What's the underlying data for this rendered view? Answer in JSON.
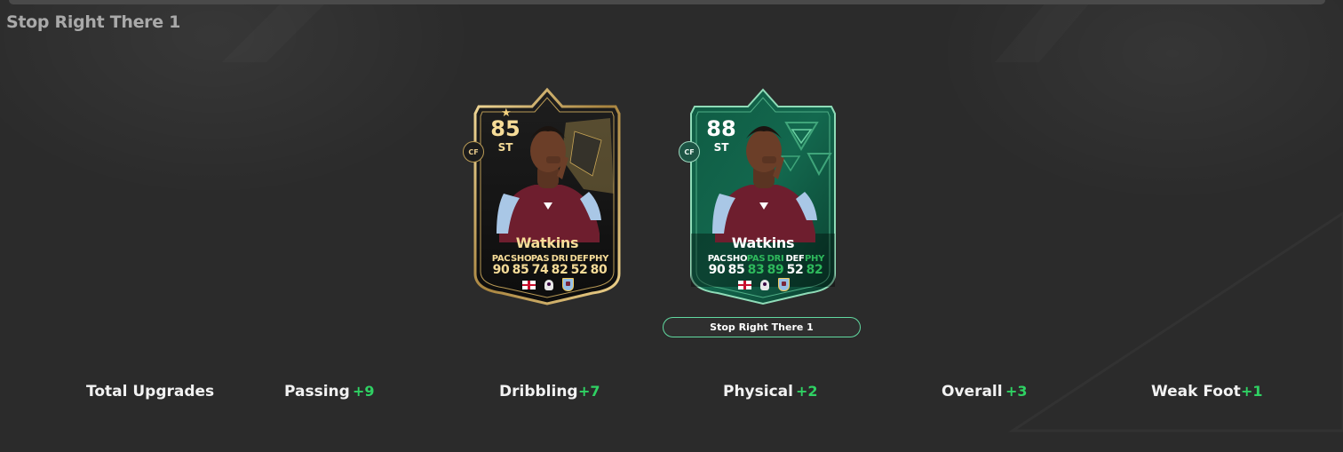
{
  "page": {
    "title": "Stop Right There 1"
  },
  "cards": {
    "base": {
      "rating": "85",
      "position": "ST",
      "alt_position": "CF",
      "name": "Watkins",
      "stats": [
        {
          "label": "PAC",
          "value": "90"
        },
        {
          "label": "SHO",
          "value": "85"
        },
        {
          "label": "PAS",
          "value": "74"
        },
        {
          "label": "DRI",
          "value": "82"
        },
        {
          "label": "DEF",
          "value": "52"
        },
        {
          "label": "PHY",
          "value": "80"
        }
      ],
      "theme_color": "#b99a55",
      "nation_icon": "england-flag-icon",
      "league_icon": "premier-league-icon",
      "club_icon": "aston-villa-crest-icon"
    },
    "evolved": {
      "rating": "88",
      "position": "ST",
      "alt_position": "CF",
      "name": "Watkins",
      "stats": [
        {
          "label": "PAC",
          "value": "90"
        },
        {
          "label": "SHO",
          "value": "85"
        },
        {
          "label": "PAS",
          "value": "83"
        },
        {
          "label": "DRI",
          "value": "89"
        },
        {
          "label": "DEF",
          "value": "52"
        },
        {
          "label": "PHY",
          "value": "82"
        }
      ],
      "theme_color": "#1d6b4f",
      "upgraded_color": "#2eb85c",
      "nation_icon": "england-flag-icon",
      "league_icon": "premier-league-icon",
      "club_icon": "aston-villa-crest-icon"
    }
  },
  "evolution_button": {
    "label": "Stop Right There 1",
    "border_color": "#61d9a0"
  },
  "upgrades": {
    "title": "Total Upgrades",
    "items": [
      {
        "label": "Passing",
        "delta": "+9"
      },
      {
        "label": "Dribbling",
        "delta": "+7"
      },
      {
        "label": "Physical",
        "delta": "+2"
      },
      {
        "label": "Overall",
        "delta": "+3"
      },
      {
        "label": "Weak Foot",
        "delta": "+1"
      }
    ],
    "delta_color": "#2fd163"
  }
}
